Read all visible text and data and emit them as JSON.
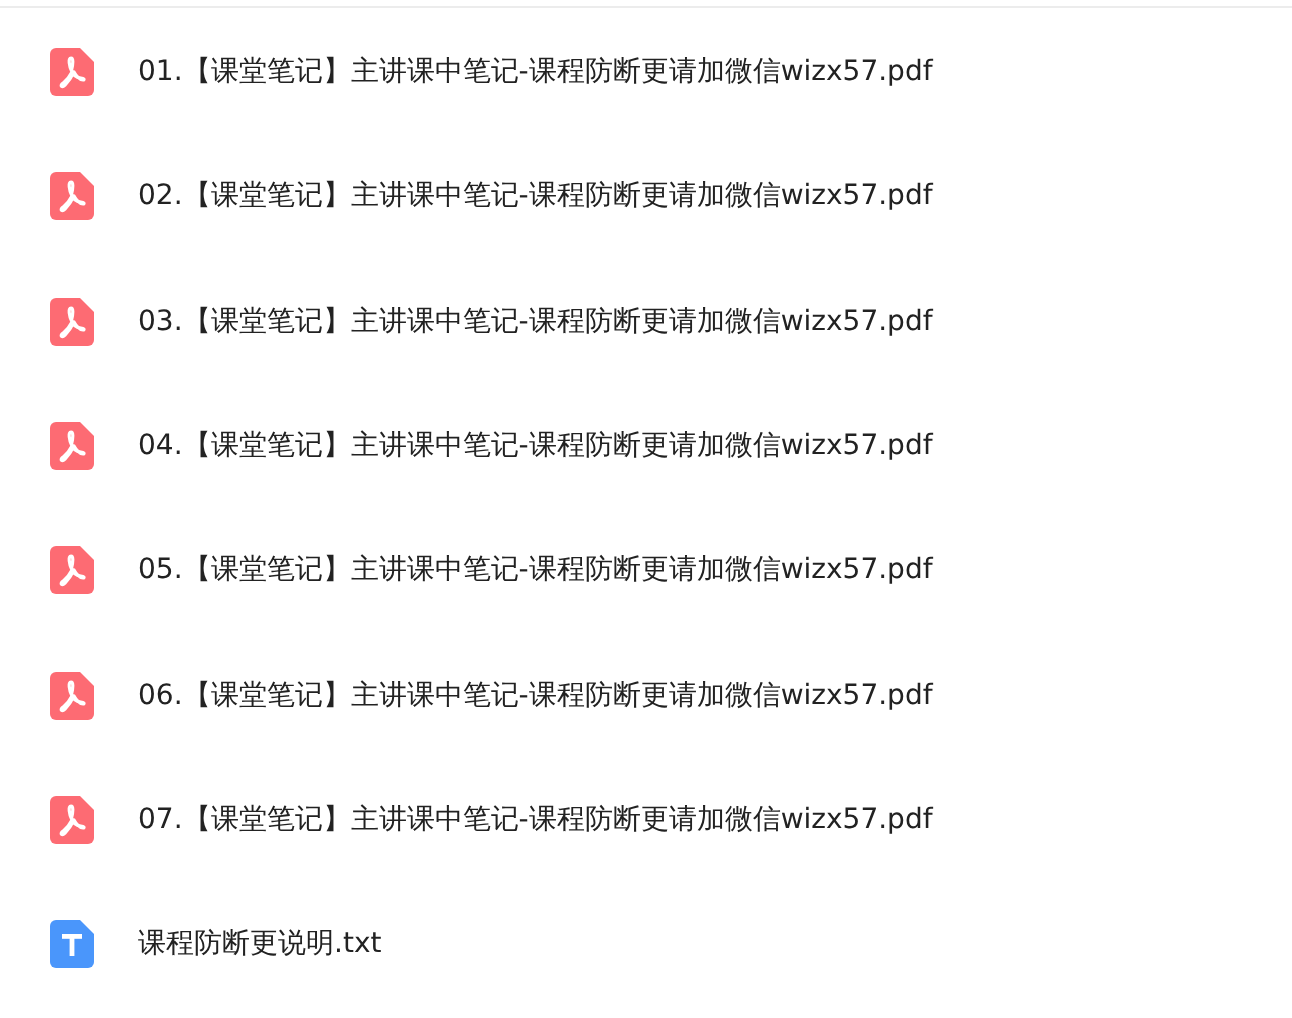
{
  "files": [
    {
      "kind": "pdf",
      "name": "01.【课堂笔记】主讲课中笔记-课程防断更请加微信wizx57.pdf"
    },
    {
      "kind": "pdf",
      "name": "02.【课堂笔记】主讲课中笔记-课程防断更请加微信wizx57.pdf"
    },
    {
      "kind": "pdf",
      "name": "03.【课堂笔记】主讲课中笔记-课程防断更请加微信wizx57.pdf"
    },
    {
      "kind": "pdf",
      "name": "04.【课堂笔记】主讲课中笔记-课程防断更请加微信wizx57.pdf"
    },
    {
      "kind": "pdf",
      "name": "05.【课堂笔记】主讲课中笔记-课程防断更请加微信wizx57.pdf"
    },
    {
      "kind": "pdf",
      "name": "06.【课堂笔记】主讲课中笔记-课程防断更请加微信wizx57.pdf"
    },
    {
      "kind": "pdf",
      "name": "07.【课堂笔记】主讲课中笔记-课程防断更请加微信wizx57.pdf"
    },
    {
      "kind": "txt",
      "name": "课程防断更说明.txt"
    }
  ]
}
